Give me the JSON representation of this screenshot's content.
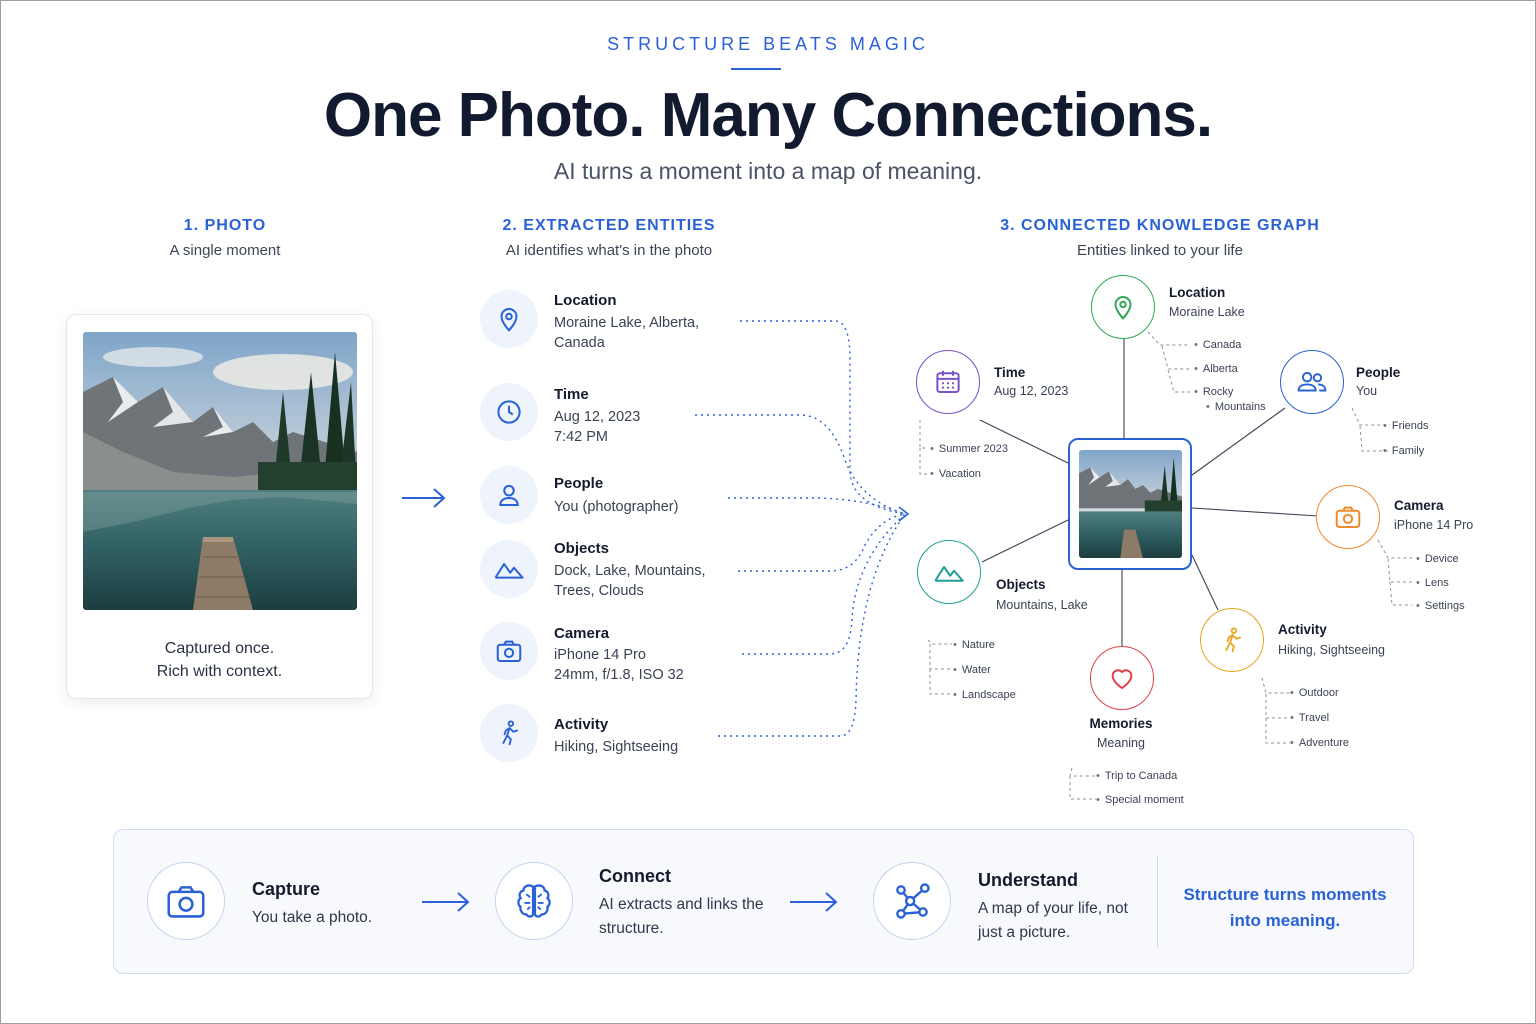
{
  "header": {
    "eyebrow": "STRUCTURE BEATS MAGIC",
    "title": "One Photo. Many Connections.",
    "subtitle": "AI turns a moment into a map of meaning."
  },
  "columns": {
    "photo": {
      "heading": "1. PHOTO",
      "sub": "A single moment"
    },
    "entities": {
      "heading": "2. EXTRACTED ENTITIES",
      "sub": "AI identifies what's in the photo"
    },
    "graph": {
      "heading": "3. CONNECTED KNOWLEDGE GRAPH",
      "sub": "Entities linked to your life"
    }
  },
  "photo_card": {
    "caption_line1": "Captured once.",
    "caption_line2": "Rich with context."
  },
  "entities": [
    {
      "icon": "location-pin-icon",
      "title": "Location",
      "lines": [
        "Moraine Lake, Alberta,",
        "Canada"
      ]
    },
    {
      "icon": "clock-icon",
      "title": "Time",
      "lines": [
        "Aug 12, 2023",
        "7:42 PM"
      ]
    },
    {
      "icon": "person-icon",
      "title": "People",
      "lines": [
        "You (photographer)"
      ]
    },
    {
      "icon": "mountain-icon",
      "title": "Objects",
      "lines": [
        "Dock, Lake, Mountains,",
        "Trees, Clouds"
      ]
    },
    {
      "icon": "camera-icon",
      "title": "Camera",
      "lines": [
        "iPhone 14 Pro",
        "24mm, f/1.8, ISO 32"
      ]
    },
    {
      "icon": "hiker-icon",
      "title": "Activity",
      "lines": [
        "Hiking, Sightseeing"
      ]
    }
  ],
  "graph": {
    "nodes": [
      {
        "id": "location",
        "icon": "location-pin-icon",
        "color": "#2fa858",
        "title": "Location",
        "sub": "Moraine Lake",
        "leaves": [
          "Canada",
          "Alberta",
          "Rocky",
          "Mountains"
        ]
      },
      {
        "id": "time",
        "icon": "calendar-icon",
        "color": "#7b52c9",
        "title": "Time",
        "sub": "Aug 12, 2023",
        "leaves": [
          "Summer 2023",
          "Vacation"
        ]
      },
      {
        "id": "people",
        "icon": "people-icon",
        "color": "#2a62d6",
        "title": "People",
        "sub": "You",
        "leaves": [
          "Friends",
          "Family"
        ]
      },
      {
        "id": "camera",
        "icon": "camera-icon",
        "color": "#f08a2e",
        "title": "Camera",
        "sub": "iPhone 14 Pro",
        "leaves": [
          "Device",
          "Lens",
          "Settings"
        ]
      },
      {
        "id": "objects",
        "icon": "mountain-icon",
        "color": "#1f9e95",
        "title": "Objects",
        "sub": "Mountains, Lake",
        "leaves": [
          "Nature",
          "Water",
          "Landscape"
        ]
      },
      {
        "id": "activity",
        "icon": "hiker-icon",
        "color": "#e6a823",
        "title": "Activity",
        "sub": "Hiking, Sightseeing",
        "leaves": [
          "Outdoor",
          "Travel",
          "Adventure"
        ]
      },
      {
        "id": "memories",
        "icon": "heart-icon",
        "color": "#e0424a",
        "title": "Memories",
        "sub": "Meaning",
        "leaves": [
          "Trip to Canada",
          "Special moment"
        ]
      }
    ]
  },
  "steps": [
    {
      "icon": "camera-icon",
      "title": "Capture",
      "text": "You take a photo."
    },
    {
      "icon": "brain-icon",
      "title": "Connect",
      "text": "AI extracts and links the structure."
    },
    {
      "icon": "network-icon",
      "title": "Understand",
      "text": "A map of your life, not just a picture."
    }
  ],
  "tagline": "Structure turns moments into meaning.",
  "colors": {
    "accent": "#2a62d6",
    "ink": "#111a2e"
  }
}
